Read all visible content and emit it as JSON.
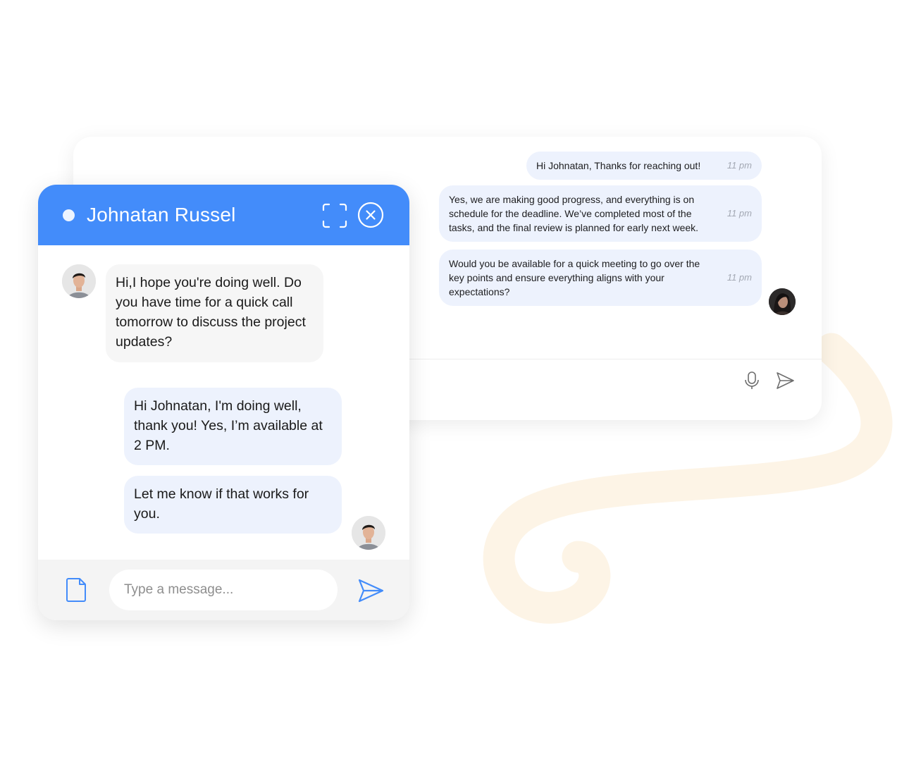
{
  "chat_widget": {
    "contact_name": "Johnatan Russel",
    "icons": {
      "status": "online-status-dot",
      "expand": "expand-icon",
      "close": "close-circle-icon",
      "attach": "document-icon",
      "send": "send-icon"
    },
    "messages": [
      {
        "side": "incoming",
        "text": "Hi,I hope you're doing well. Do you have time for a quick call tomorrow to discuss the project updates?"
      },
      {
        "side": "outgoing",
        "text": "Hi Johnatan, I'm doing well, thank you! Yes, I’m available at 2 PM."
      },
      {
        "side": "outgoing",
        "text": "Let me know if that works for you."
      }
    ],
    "input": {
      "placeholder": "Type a message...",
      "value": ""
    }
  },
  "background_chat": {
    "messages": [
      {
        "text": "Hi Johnatan, Thanks for reaching out!",
        "time": "11 pm"
      },
      {
        "text": "Yes, we are making good progress, and everything is on schedule for the deadline. We’ve completed most of the tasks, and the final review is planned for early next week.",
        "time": "11 pm"
      },
      {
        "text": "Would you be available for a quick meeting to go over the key points and ensure everything aligns with your expectations?",
        "time": "11 pm"
      }
    ],
    "icons": {
      "mic": "microphone-icon",
      "send": "send-icon"
    }
  },
  "colors": {
    "accent": "#438cfa",
    "bubble_out": "#edf2fd",
    "bubble_in": "#f6f6f6",
    "decor": "#fdf4e6"
  }
}
